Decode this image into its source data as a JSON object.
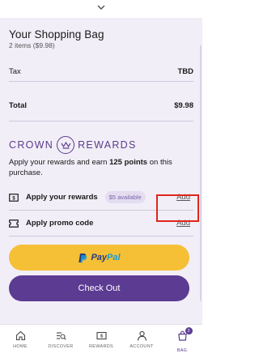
{
  "header": {
    "title": "Your Shopping Bag",
    "subtitle": "2 items ($9.98)"
  },
  "summary": {
    "tax_label": "Tax",
    "tax_value": "TBD",
    "total_label": "Total",
    "total_value": "$9.98"
  },
  "rewards": {
    "brand_left": "CROWN",
    "brand_right": "REWARDS",
    "text_before": "Apply your rewards and earn ",
    "points": "125 points",
    "text_after": " on this purchase."
  },
  "options": {
    "rewards_label": "Apply your rewards",
    "rewards_pill": "$5 available",
    "rewards_add": "Add",
    "promo_label": "Apply promo code",
    "promo_add": "Add"
  },
  "buttons": {
    "paypal_pay": "Pay",
    "paypal_pal": "Pal",
    "checkout": "Check Out"
  },
  "tabbar": {
    "items": [
      {
        "label": "HOME",
        "icon": "home-icon"
      },
      {
        "label": "DISCOVER",
        "icon": "discover-icon"
      },
      {
        "label": "REWARDS",
        "icon": "rewards-icon"
      },
      {
        "label": "ACCOUNT",
        "icon": "account-icon"
      },
      {
        "label": "BAG",
        "icon": "bag-icon",
        "badge": "2",
        "active": true
      }
    ]
  },
  "colors": {
    "accent": "#5c3b92",
    "paypal": "#f5c036",
    "sheet_bg": "#f1eef7",
    "highlight": "#e1251b"
  }
}
